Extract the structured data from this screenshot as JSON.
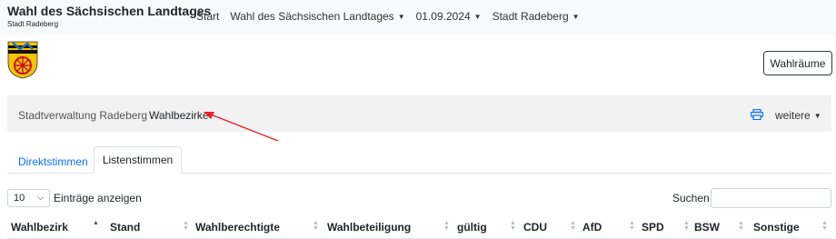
{
  "header": {
    "title": "Wahl des Sächsischen Landtages",
    "subtitle": "Stadt Radeberg",
    "nav": [
      {
        "label": "Start",
        "dropdown": false
      },
      {
        "label": "Wahl des Sächsischen Landtages",
        "dropdown": true
      },
      {
        "label": "01.09.2024",
        "dropdown": true
      },
      {
        "label": "Stadt Radeberg",
        "dropdown": true
      }
    ]
  },
  "toolbar": {
    "wahlraeume_label": "Wahlräume"
  },
  "breadcrumb": {
    "items": [
      "Stadtverwaltung Radeberg",
      "Wahlbezirke"
    ],
    "weitere_label": "weitere"
  },
  "tabs": [
    {
      "label": "Direktstimmen",
      "active": false
    },
    {
      "label": "Listenstimmen",
      "active": true
    }
  ],
  "table_controls": {
    "length_value": "10",
    "length_label": "Einträge anzeigen",
    "search_label": "Suchen",
    "search_value": ""
  },
  "table": {
    "columns": [
      "Wahlbezirk",
      "Stand",
      "Wahlberechtigte",
      "Wahlbeteiligung",
      "gültig",
      "CDU",
      "AfD",
      "SPD",
      "BSW",
      "Sonstige"
    ]
  },
  "icons": {
    "print": "printer-icon",
    "caret": "caret-down-icon",
    "logo": "coat-of-arms-icon"
  },
  "colors": {
    "link": "#0d6efd",
    "annotation_arrow": "#e3262b",
    "navbar_bg": "#f8f9fa",
    "breadcrumb_bg": "#f2f2f2"
  }
}
